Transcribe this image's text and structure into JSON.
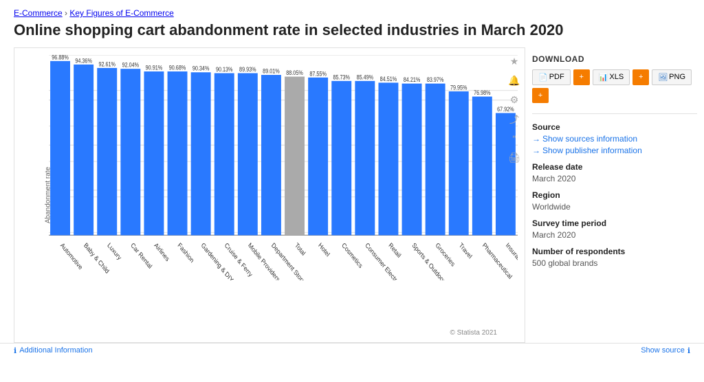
{
  "breadcrumb": {
    "link1": "E-Commerce",
    "separator": "›",
    "link2": "Key Figures of E-Commerce"
  },
  "title": "Online shopping cart abandonment rate in selected industries in March 2020",
  "chart": {
    "yAxisLabel": "Abandonment rate",
    "yTicks": [
      "0%",
      "25%",
      "50%",
      "75%",
      "100%",
      "125%"
    ],
    "bars": [
      {
        "label": "Automotive",
        "value": 96.88,
        "highlight": false
      },
      {
        "label": "Baby & Child",
        "value": 94.36,
        "highlight": false
      },
      {
        "label": "Luxury",
        "value": 92.61,
        "highlight": false
      },
      {
        "label": "Car Rental",
        "value": 92.04,
        "highlight": false
      },
      {
        "label": "Airlines",
        "value": 90.91,
        "highlight": false
      },
      {
        "label": "Fashion",
        "value": 90.68,
        "highlight": false
      },
      {
        "label": "Gardening & DIY",
        "value": 90.34,
        "highlight": false
      },
      {
        "label": "Cruise & Ferry",
        "value": 90.13,
        "highlight": false
      },
      {
        "label": "Mobile Providers",
        "value": 89.93,
        "highlight": false
      },
      {
        "label": "Department Store",
        "value": 89.01,
        "highlight": false
      },
      {
        "label": "Total",
        "value": 88.05,
        "highlight": true
      },
      {
        "label": "Hotel",
        "value": 87.55,
        "highlight": false
      },
      {
        "label": "Cosmetics",
        "value": 85.73,
        "highlight": false
      },
      {
        "label": "Consumer Electronics",
        "value": 85.49,
        "highlight": false
      },
      {
        "label": "Retail",
        "value": 84.51,
        "highlight": false
      },
      {
        "label": "Sports & Outdoor",
        "value": 84.21,
        "highlight": false
      },
      {
        "label": "Groceries",
        "value": 83.97,
        "highlight": false
      },
      {
        "label": "Travel",
        "value": 79.95,
        "highlight": false
      },
      {
        "label": "Pharmaceutical",
        "value": 76.98,
        "highlight": false
      },
      {
        "label": "Insurance",
        "value": 67.92,
        "highlight": false
      }
    ]
  },
  "icons": {
    "star": "★",
    "bell": "🔔",
    "gear": "⚙",
    "share": "⤴",
    "quote": "❝",
    "print": "🖨"
  },
  "download": {
    "title": "DOWNLOAD",
    "pdf": "PDF",
    "xls": "XLS",
    "png": "PNG"
  },
  "source": {
    "label": "Source",
    "link1": "Show sources information",
    "link2": "Show publisher information"
  },
  "release_date": {
    "label": "Release date",
    "value": "March 2020"
  },
  "region": {
    "label": "Region",
    "value": "Worldwide"
  },
  "survey_period": {
    "label": "Survey time period",
    "value": "March 2020"
  },
  "respondents": {
    "label": "Number of respondents",
    "value": "500 global brands"
  },
  "footer": {
    "additional_info": "Additional Information",
    "show_source": "Show source",
    "statista": "© Statista 2021"
  }
}
